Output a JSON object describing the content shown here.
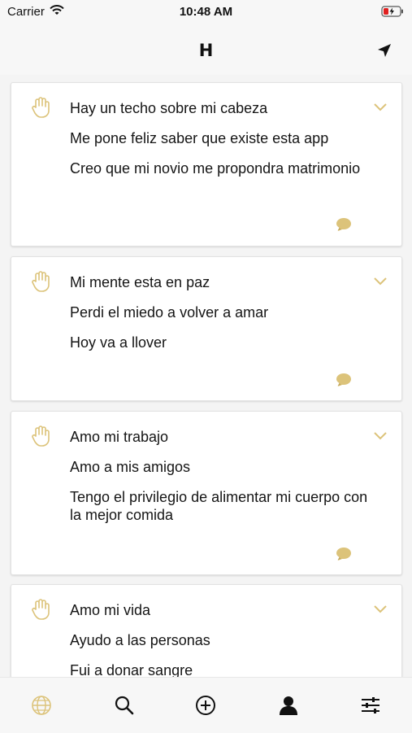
{
  "status_bar": {
    "carrier": "Carrier",
    "time": "10:48 AM"
  },
  "header": {
    "logo": "H"
  },
  "colors": {
    "accent": "#dcc37a",
    "icon": "#111111"
  },
  "cards": [
    {
      "lines": [
        "Hay un techo sobre mi cabeza",
        "Me pone feliz saber que existe esta app",
        "Creo que mi novio me propondra matrimonio"
      ]
    },
    {
      "lines": [
        "Mi mente esta en paz",
        "Perdi el miedo a volver a amar",
        "Hoy va a llover"
      ]
    },
    {
      "lines": [
        "Amo mi trabajo",
        "Amo a mis amigos",
        "Tengo el privilegio de alimentar mi cuerpo con la mejor comida"
      ]
    },
    {
      "lines": [
        "Amo mi vida",
        "Ayudo a las personas",
        "Fui a donar sangre"
      ]
    }
  ],
  "tab_bar": {
    "selected": "globe-icon"
  }
}
